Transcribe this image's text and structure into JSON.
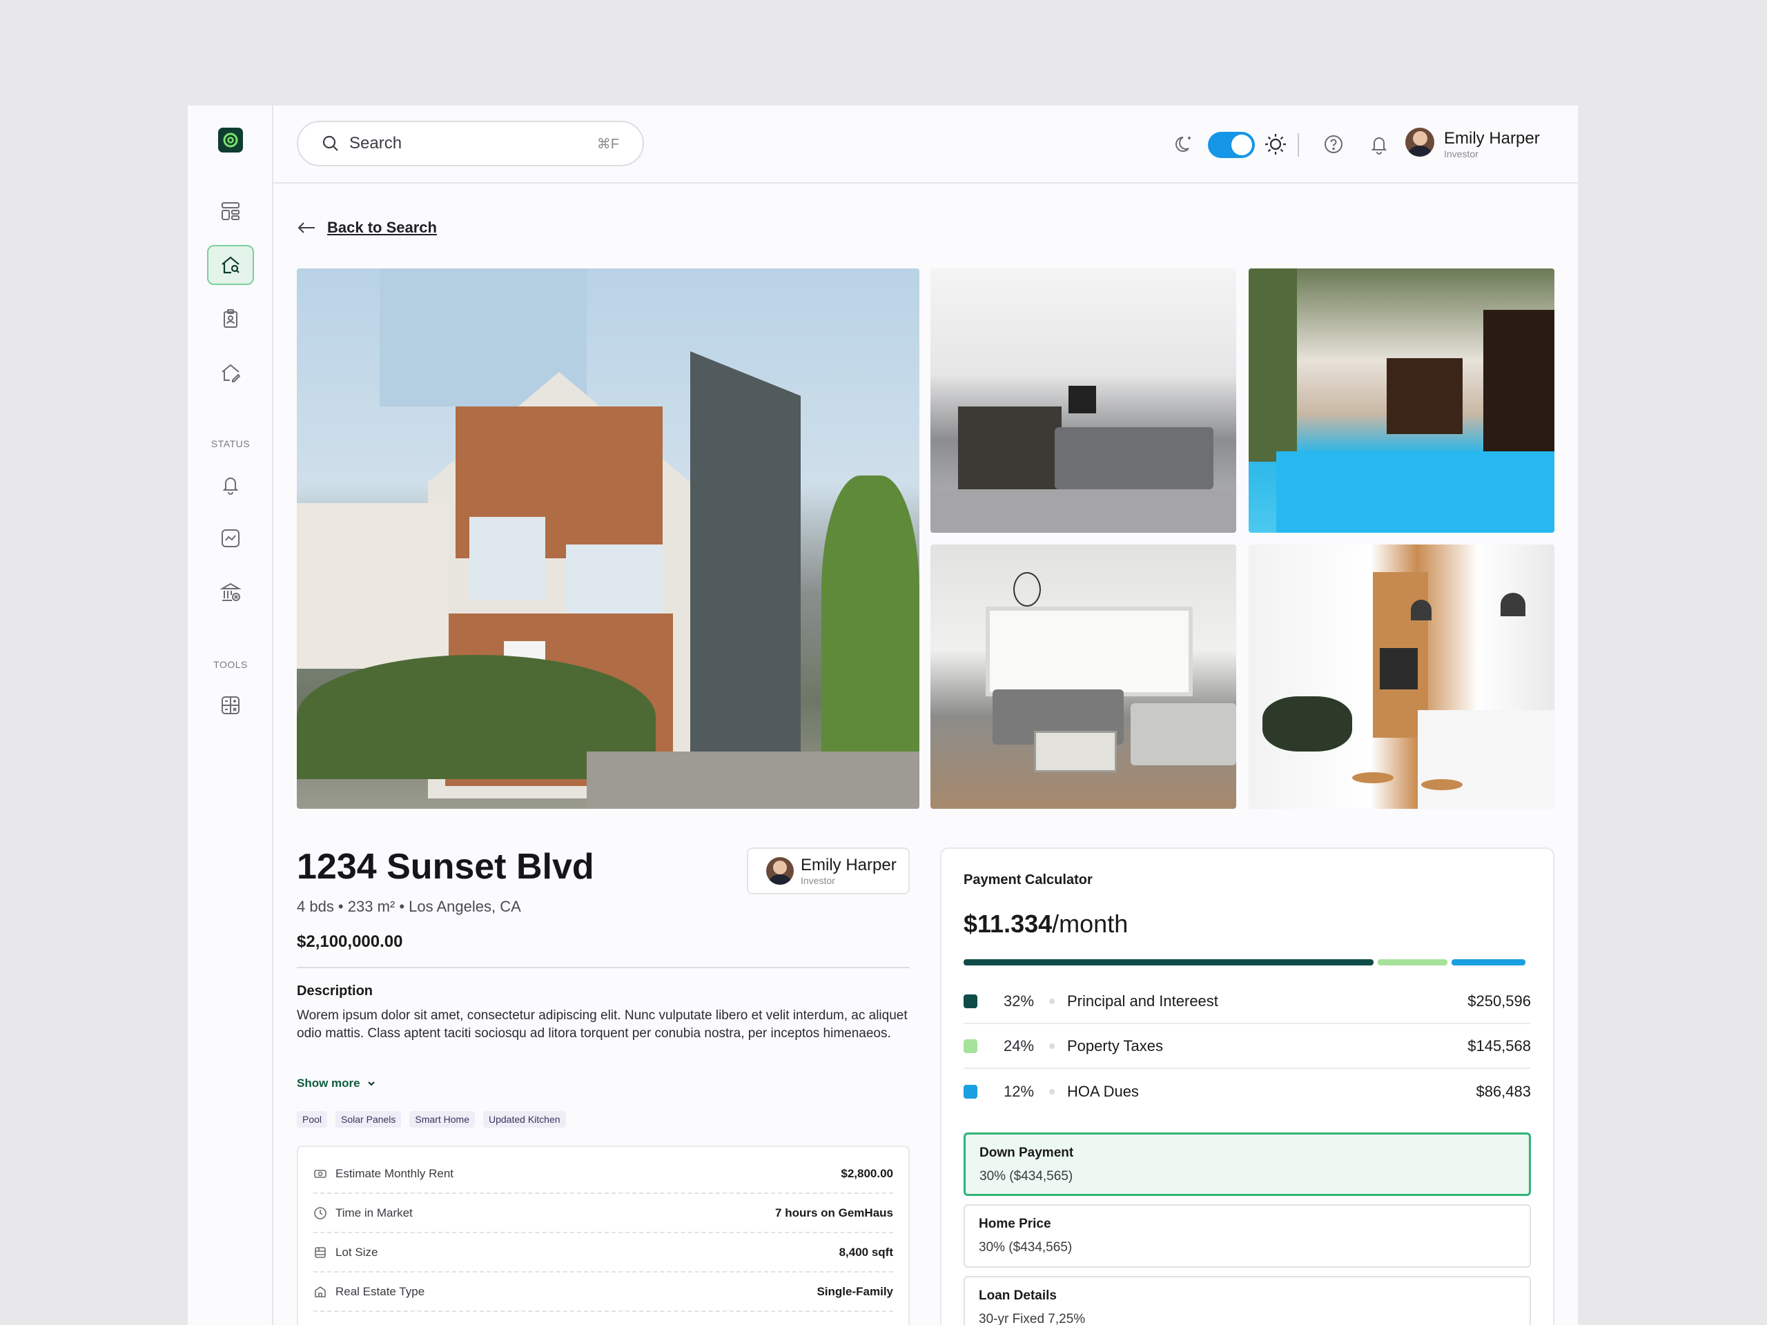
{
  "header": {
    "search_placeholder": "Search",
    "search_shortcut": "⌘F",
    "user_name": "Emily Harper",
    "user_role": "Investor"
  },
  "sidebar": {
    "status_label": "STATUS",
    "tools_label": "TOOLS"
  },
  "nav": {
    "back_label": "Back to Search"
  },
  "property": {
    "title": "1234 Sunset Blvd",
    "meta": "4 bds • 233 m² • Los Angeles, CA",
    "price": "$2,100,000.00",
    "agent_name": "Emily Harper",
    "agent_role": "Investor",
    "description_heading": "Description",
    "description": "Worem ipsum dolor sit amet, consectetur adipiscing elit. Nunc vulputate libero et velit interdum, ac aliquet odio mattis. Class aptent taciti sociosqu ad litora torquent per conubia nostra, per inceptos himenaeos.",
    "show_more": "Show more",
    "tags": [
      "Pool",
      "Solar Panels",
      "Smart Home",
      "Updated Kitchen"
    ],
    "facts": [
      {
        "label": "Estimate Monthly Rent",
        "value": "$2,800.00"
      },
      {
        "label": "Time in Market",
        "value": "7 hours on GemHaus"
      },
      {
        "label": "Lot Size",
        "value": "8,400 sqft"
      },
      {
        "label": "Real Estate Type",
        "value": "Single-Family"
      }
    ]
  },
  "calculator": {
    "heading": "Payment Calculator",
    "amount": "$11.334",
    "period": "/month",
    "rows": [
      {
        "pct": "32%",
        "label": "Principal and Intereest",
        "amount": "$250,596",
        "color": "#0e4d47"
      },
      {
        "pct": "24%",
        "label": "Poperty Taxes",
        "amount": "$145,568",
        "color": "#a6e29b"
      },
      {
        "pct": "12%",
        "label": "HOA Dues",
        "amount": "$86,483",
        "color": "#1a9fe0"
      }
    ],
    "bar_fractions": [
      0.73,
      0.13,
      0.13
    ],
    "boxes": [
      {
        "heading": "Down Payment",
        "value": "30% ($434,565)"
      },
      {
        "heading": "Home Price",
        "value": "30% ($434,565)"
      },
      {
        "heading": "Loan Details",
        "value": "30-yr Fixed 7,25%"
      }
    ]
  },
  "colors": {
    "accent": "#1596e6",
    "brand": "#0f3d2f",
    "selected_border": "#2fb473"
  }
}
